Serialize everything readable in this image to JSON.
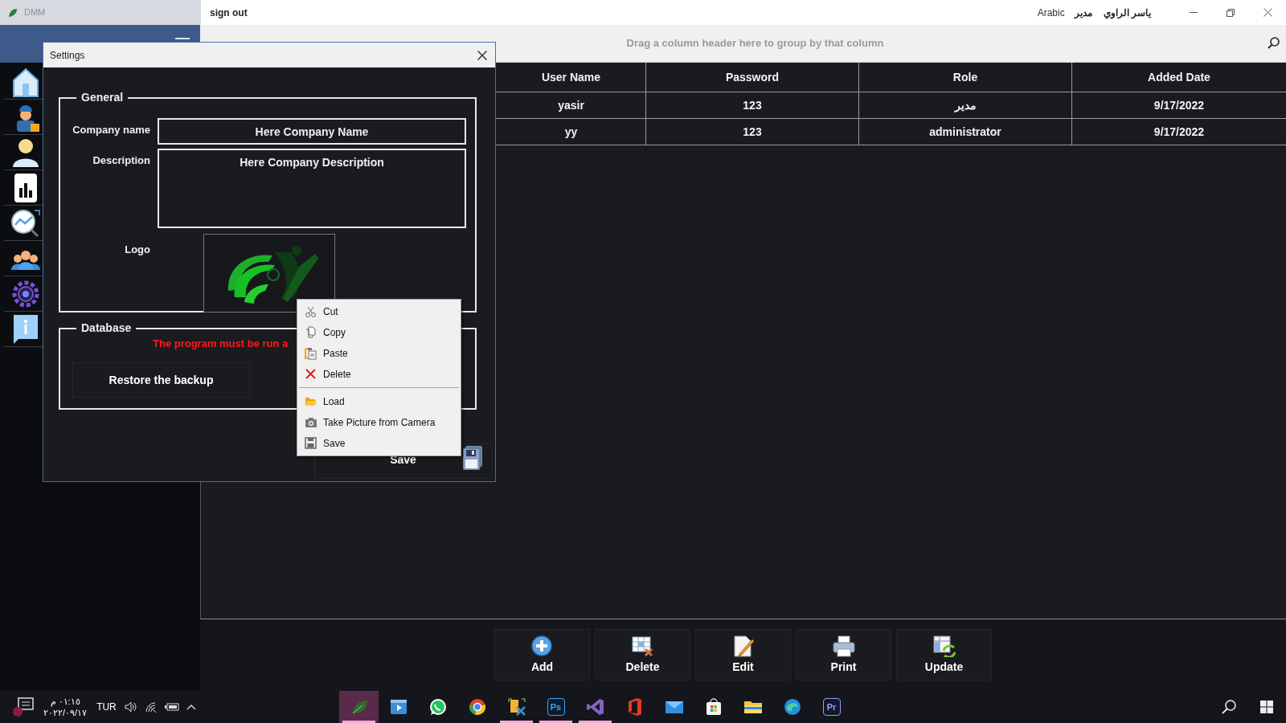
{
  "app": {
    "title": "DMM"
  },
  "top_bar": {
    "sign_out": "sign out",
    "language": "Arabic",
    "user_role": "مدير",
    "user_name": "ياسر الراوي"
  },
  "sidebar": {
    "items": [
      {
        "kind": "home"
      },
      {
        "kind": "worker"
      },
      {
        "kind": "user"
      },
      {
        "kind": "report"
      },
      {
        "kind": "trend"
      },
      {
        "kind": "team"
      },
      {
        "kind": "settings"
      },
      {
        "kind": "info"
      }
    ]
  },
  "grid": {
    "group_panel_hint": "Drag a column header here to group by that column",
    "columns": [
      "User Name",
      "Password",
      "Role",
      "Added Date"
    ],
    "rows": [
      [
        "yasir",
        "123",
        "مدير",
        "9/17/2022"
      ],
      [
        "yy",
        "123",
        "administrator",
        "9/17/2022"
      ]
    ]
  },
  "toolbar": [
    {
      "kind": "add",
      "label": "Add"
    },
    {
      "kind": "delete",
      "label": "Delete"
    },
    {
      "kind": "edit",
      "label": "Edit"
    },
    {
      "kind": "print",
      "label": "Print"
    },
    {
      "kind": "update",
      "label": "Update"
    }
  ],
  "dialog": {
    "title": "Settings",
    "general": {
      "legend": "General",
      "fields": [
        {
          "label": "Company name",
          "value": "Here Company Name",
          "kind": "line"
        },
        {
          "label": "Description",
          "value": "Here Company Description",
          "kind": "area"
        }
      ],
      "logo_label": "Logo"
    },
    "database": {
      "legend": "Database",
      "warning": "The program must be run a",
      "restore_button": "Restore the backup"
    },
    "save_button": "Save"
  },
  "context_menu": {
    "groups": [
      [
        {
          "kind": "cut",
          "label": "Cut"
        },
        {
          "kind": "copy",
          "label": "Copy"
        },
        {
          "kind": "paste",
          "label": "Paste"
        },
        {
          "kind": "delete",
          "label": "Delete"
        }
      ],
      [
        {
          "kind": "load",
          "label": "Load"
        },
        {
          "kind": "camera",
          "label": "Take Picture from Camera"
        },
        {
          "kind": "save",
          "label": "Save"
        }
      ]
    ]
  },
  "taskbar": {
    "time": "٠١:١٥ م",
    "date": "٢٠٢٢/٠٩/١٧",
    "language": "TUR",
    "apps": [
      {
        "kind": "leaf",
        "selected": true,
        "running": true
      },
      {
        "kind": "film",
        "selected": false,
        "running": false
      },
      {
        "kind": "chat",
        "selected": false,
        "running": false
      },
      {
        "kind": "browser",
        "selected": false,
        "running": false
      },
      {
        "kind": "tools",
        "selected": false,
        "running": true
      },
      {
        "kind": "lettered",
        "label": "Ps",
        "color": "#31a8ff",
        "selected": false,
        "running": true
      },
      {
        "kind": "studio",
        "selected": false,
        "running": true
      },
      {
        "kind": "office",
        "selected": false,
        "running": false
      },
      {
        "kind": "mail",
        "selected": false,
        "running": false
      },
      {
        "kind": "store",
        "selected": false,
        "running": false
      },
      {
        "kind": "folder",
        "selected": false,
        "running": false
      },
      {
        "kind": "wave",
        "selected": false,
        "running": false
      },
      {
        "kind": "lettered",
        "label": "Pr",
        "color": "#9999ff",
        "selected": false,
        "running": false
      }
    ]
  }
}
